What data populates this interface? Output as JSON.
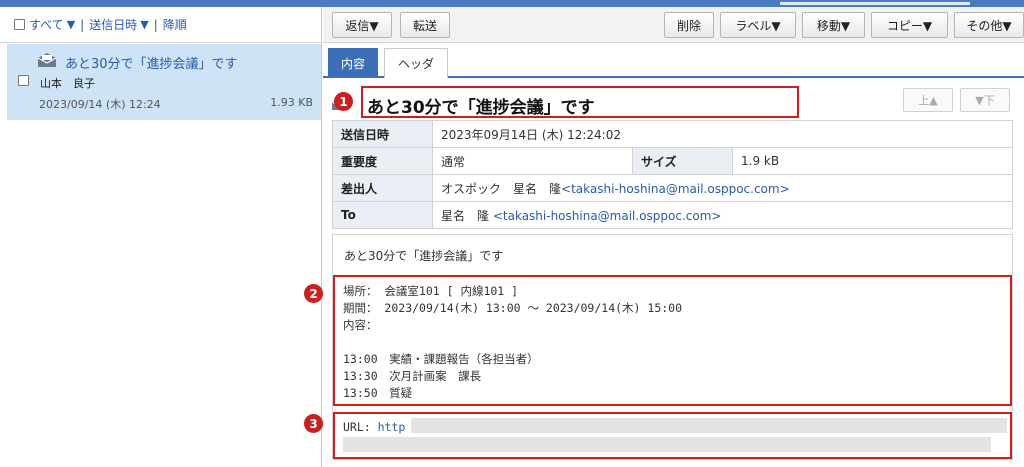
{
  "list_header": {
    "select_all": "すべて",
    "sort_field": "送信日時",
    "sort_order": "降順",
    "separator": "|",
    "arrow": "▼"
  },
  "message_list": [
    {
      "subject": "あと30分で「進捗会議」です",
      "from": "山本　良子",
      "date": "2023/09/14 (木) 12:24",
      "size": "1.93 KB"
    }
  ],
  "toolbar": {
    "reply": "返信▼",
    "forward": "転送",
    "delete": "削除",
    "label": "ラベル▼",
    "move": "移動▼",
    "copy": "コピー▼",
    "other": "その他▼"
  },
  "tabs": {
    "content": "内容",
    "header": "ヘッダ"
  },
  "message": {
    "title": "あと30分で「進捗会議」です",
    "nav_up": "上▲",
    "nav_down": "▼下",
    "headers": {
      "sent_label": "送信日時",
      "sent_value": "2023年09月14日 (木) 12:24:02",
      "priority_label": "重要度",
      "priority_value": "通常",
      "size_label": "サイズ",
      "size_value": "1.9 kB",
      "from_label": "差出人",
      "from_name": "オスポック　星名　隆",
      "from_email": "<takashi-hoshina@mail.osppoc.com>",
      "to_label": "To",
      "to_name": "星名　隆",
      "to_email": "<takashi-hoshina@mail.osppoc.com>"
    },
    "body_first": "あと30分で「進捗会議」です",
    "body_block": "場所： 会議室101 [ 内線101 ]\n期間： 2023/09/14(木) 13:00 ～ 2023/09/14(木) 15:00\n内容：\n\n13:00　実績・課題報告（各担当者）\n13:30　次月計画案　課長\n13:50　質疑",
    "url_label": "URL: ",
    "url_link": "http"
  },
  "annotations": {
    "one": "1",
    "two": "2",
    "three": "3"
  },
  "colors": {
    "accent": "#3d6fb6",
    "highlight": "#cc1f1f",
    "selected_row": "#cfe3f7"
  }
}
